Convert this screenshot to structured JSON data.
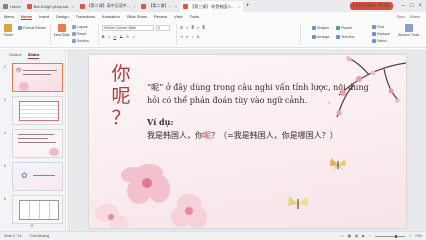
{
  "titlebar": {
    "tabs": [
      {
        "label": "Home",
        "color": "#7b7f86"
      },
      {
        "label": "Bài 8-Ngữ pháp bài",
        "color": "#e3533a"
      },
      {
        "label": "【第二课】高中汉语中...",
        "color": "#e3533a"
      },
      {
        "label": "【第二课】...",
        "color": "#e3533a"
      },
      {
        "label": "【第三课】 你是韩国人...",
        "color": "#e3533a"
      }
    ],
    "signin": "Upgrade Now"
  },
  "menubar": {
    "items": [
      "Menu",
      "Home",
      "Insert",
      "Design",
      "Transitions",
      "Animation",
      "Slide Show",
      "Review",
      "View",
      "Tools"
    ],
    "active": "Home",
    "right": [
      "Sync",
      "Share"
    ]
  },
  "ribbon": {
    "paste": "Paste",
    "format": "Format Painter",
    "new_slide": "New Slide",
    "layout": "Layout",
    "reset": "Reset",
    "section": "Section",
    "font_name": "Simhei Current Slide",
    "font_size": "0",
    "shapes": "Shapes",
    "arrange": "Arrange",
    "picture": "Picture",
    "textbox": "Text Box",
    "find": "Find",
    "select": "Select",
    "replace": "Replace",
    "student": "Student Tools"
  },
  "leftpanel": {
    "tabs": [
      "Outline",
      "Slides"
    ],
    "active_tab": "Slides",
    "thumbs": [
      {
        "num": "2",
        "selected": true
      },
      {
        "num": "3",
        "selected": false
      },
      {
        "num": "4",
        "selected": false
      },
      {
        "num": "5",
        "selected": false
      },
      {
        "num": "6",
        "selected": false
      }
    ],
    "add": "+"
  },
  "slide": {
    "vertical_title_chars": [
      "你",
      "呢",
      "？"
    ],
    "body": "“呢” ở đây dùng trong câu nghi vấn tỉnh lược, nội dung hỏi có thể phán đoán tùy vào ngữ cảnh.",
    "label": "Ví dụ:",
    "example_a": "我是韩国人，你",
    "example_hl": "呢",
    "example_b": "？（=我是韩国人，你是哪国人？）"
  },
  "statusbar": {
    "slide_info": "Slide 2 / 16",
    "theme": "Font Missing",
    "zoom": "70%"
  },
  "colors": {
    "accent": "#c0392b",
    "slide_title": "#b23a3a"
  }
}
